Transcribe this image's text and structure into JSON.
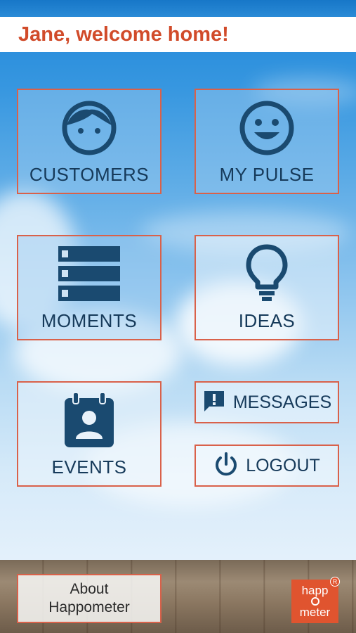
{
  "header": {
    "welcome": "Jane, welcome home!"
  },
  "tiles": {
    "customers": "CUSTOMERS",
    "my_pulse": "MY PULSE",
    "moments": "MOMENTS",
    "ideas": "IDEAS",
    "events": "EVENTS",
    "messages": "MESSAGES",
    "logout": "LOGOUT"
  },
  "footer": {
    "about_line1": "About",
    "about_line2": "Happometer",
    "logo_top": "happ",
    "logo_bottom": "meter",
    "logo_reg": "R"
  },
  "colors": {
    "accent": "#d9614a",
    "icon": "#1a4a70",
    "welcome_text": "#d14b2a",
    "logo_bg": "#e0542f"
  },
  "icons": {
    "customers": "face-icon",
    "my_pulse": "smiley-icon",
    "moments": "list-icon",
    "ideas": "lightbulb-icon",
    "events": "calendar-person-icon",
    "messages": "chat-alert-icon",
    "logout": "power-icon"
  }
}
